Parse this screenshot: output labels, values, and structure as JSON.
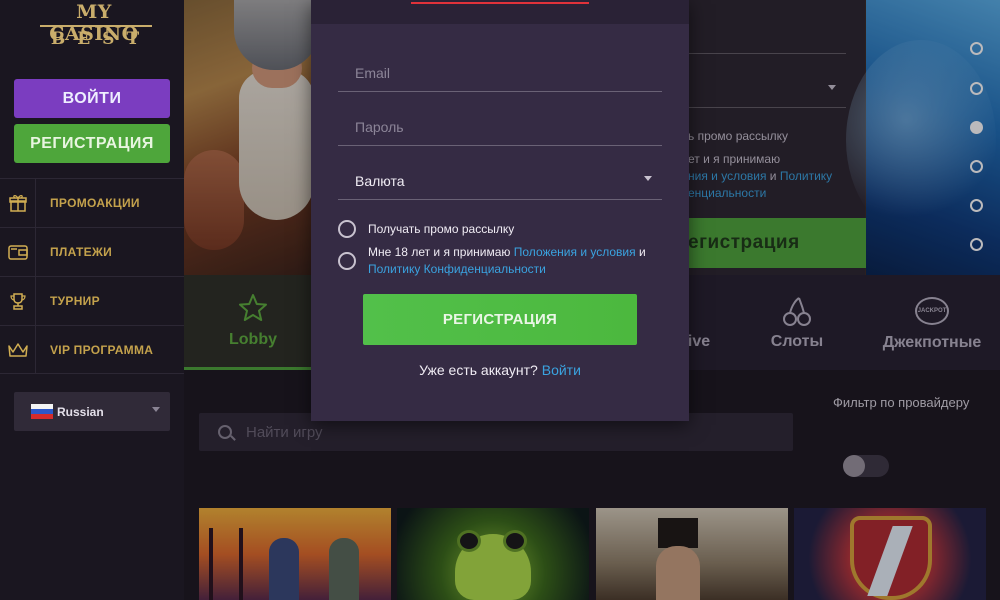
{
  "sidebar": {
    "logo_line1": "MY CASINO",
    "logo_line2": "BEST",
    "login_label": "ВОЙТИ",
    "register_label": "РЕГИСТРАЦИЯ",
    "menu": [
      {
        "label": "ПРОМОАКЦИИ",
        "icon": "gift-icon"
      },
      {
        "label": "ПЛАТЕЖИ",
        "icon": "wallet-icon"
      },
      {
        "label": "ТУРНИР",
        "icon": "trophy-icon"
      },
      {
        "label": "VIP ПРОГРАММА",
        "icon": "crown-icon"
      }
    ],
    "language": "Russian"
  },
  "background_form": {
    "promo_text": "ь промо рассылку",
    "terms_line1": "ет и я принимаю",
    "terms_link1": "ния и условия",
    "terms_and": "и",
    "terms_link2": "Политику",
    "terms_line3": "енциальности",
    "button": "егистрация"
  },
  "slider": {
    "dots": 6,
    "active_index": 2
  },
  "categories": [
    {
      "label": "Lobby",
      "icon": "star-icon",
      "active": true
    },
    {
      "label": "ive",
      "icon": "",
      "active": false
    },
    {
      "label": "Слоты",
      "icon": "cherries-icon",
      "active": false
    },
    {
      "label": "Джекпотные",
      "icon": "jackpot-icon",
      "active": false
    }
  ],
  "jackpot_badge": "JACKPOT",
  "search": {
    "placeholder": "Найти игру"
  },
  "filter": {
    "label": "Фильтр по провайдеру",
    "enabled": false
  },
  "modal": {
    "email_placeholder": "Email",
    "password_placeholder": "Пароль",
    "currency_label": "Валюта",
    "promo_label": "Получать промо рассылку",
    "terms_prefix": "Мне 18 лет и я принимаю",
    "terms_link": "Положения и условия",
    "terms_and": "и",
    "privacy_link": "Политику Конфиденциальности",
    "register_button": "РЕГИСТРАЦИЯ",
    "have_account": "Уже есть аккаунт?",
    "login_link": "Войти"
  },
  "colors": {
    "accent_purple": "#7b3dc0",
    "accent_green": "#4ea63b",
    "gold": "#c9ad6b",
    "link_blue": "#3aa3e0",
    "modal_bg": "#352b44"
  }
}
